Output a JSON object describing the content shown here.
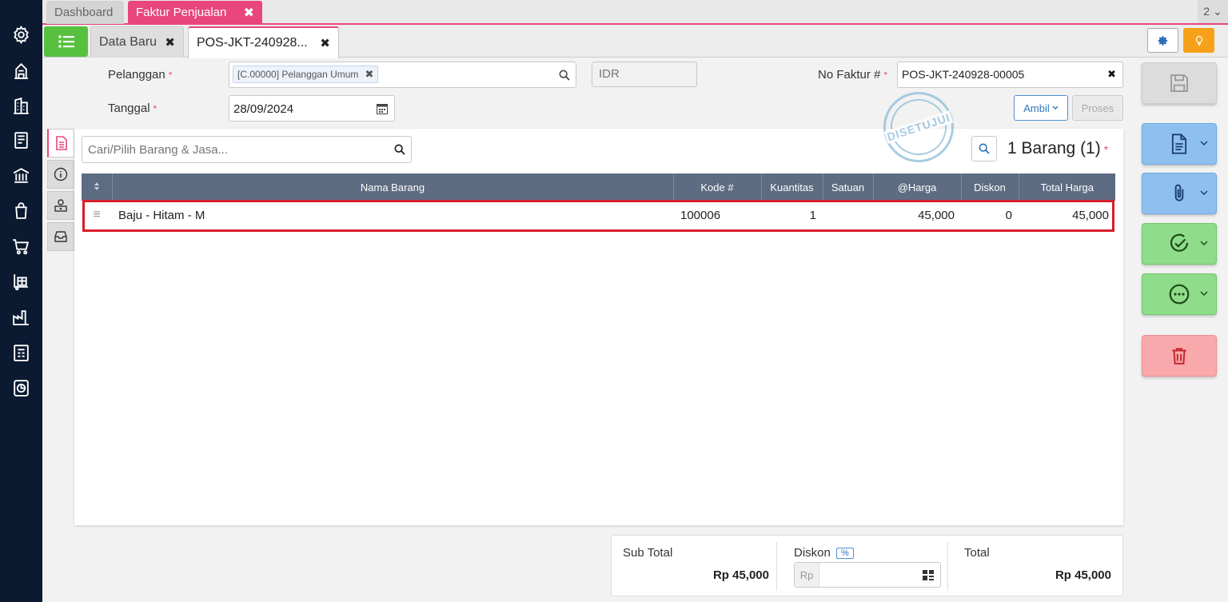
{
  "top_tabs": {
    "dashboard": "Dashboard",
    "faktur": "Faktur Penjualan",
    "count": "2 ⌄"
  },
  "sub_tabs": {
    "data_baru": "Data Baru",
    "pos": "POS-JKT-240928..."
  },
  "form": {
    "pelanggan_label": "Pelanggan",
    "pelanggan_value": "[C.00000] Pelanggan Umum",
    "currency": "IDR",
    "tanggal_label": "Tanggal",
    "tanggal_value": "28/09/2024",
    "no_faktur_label": "No Faktur #",
    "no_faktur_value": "POS-JKT-240928-00005",
    "required_mark": "*",
    "ambil_label": "Ambil",
    "proses_label": "Proses"
  },
  "items": {
    "search_placeholder": "Cari/Pilih Barang & Jasa...",
    "count_title": "1 Barang (1)",
    "stamp": "DISETUJUI",
    "columns": [
      "Nama Barang",
      "Kode #",
      "Kuantitas",
      "Satuan",
      "@Harga",
      "Diskon",
      "Total Harga"
    ],
    "rows": [
      {
        "nama": "Baju - Hitam - M",
        "kode": "100006",
        "qty": "1",
        "satuan": "",
        "harga": "45,000",
        "diskon": "0",
        "total": "45,000"
      }
    ]
  },
  "totals": {
    "subtotal_label": "Sub Total",
    "subtotal_value": "Rp 45,000",
    "diskon_label": "Diskon",
    "diskon_badge": "%",
    "diskon_prefix": "Rp",
    "total_label": "Total",
    "total_value": "Rp 45,000"
  },
  "colors": {
    "accent": "#e8467c",
    "sidebar": "#0b1931",
    "green": "#57c13f",
    "header": "#5d6c82",
    "highlight": "#d81e2b"
  }
}
